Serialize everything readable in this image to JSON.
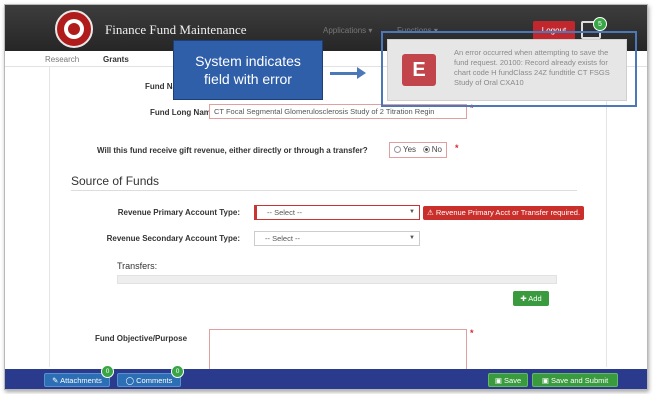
{
  "header": {
    "app_title": "Finance Fund Maintenance",
    "menu_applications": "Applications",
    "menu_functions": "Functions",
    "logout_label": "Logout",
    "notification_count": "5"
  },
  "tabs": [
    {
      "label": "Research"
    },
    {
      "label": "Grants"
    }
  ],
  "form": {
    "fund_name_label": "Fund Na",
    "fund_long_name_label": "Fund Long Name:",
    "fund_long_name_value": "CT Focal Segmental Glomerulosclerosis Study of 2 Titration Regin",
    "gift_question": "Will this fund receive gift revenue, either directly or through a transfer?",
    "gift_yes": "Yes",
    "gift_no": "No",
    "gift_selected": "No",
    "required_mark": "*",
    "section_title": "Source of Funds",
    "rev_primary_label": "Revenue Primary Account Type:",
    "rev_primary_value": "-- Select --",
    "rev_primary_error": "Revenue Primary Acct or Transfer required.",
    "rev_secondary_label": "Revenue Secondary Account Type:",
    "rev_secondary_value": "-- Select --",
    "transfers_label": "Transfers:",
    "add_label": "Add",
    "objective_label": "Fund Objective/Purpose"
  },
  "footer": {
    "attachments_label": "Attachments",
    "attachments_count": "0",
    "comments_label": "Comments",
    "comments_count": "0",
    "save_label": "Save",
    "save_submit_label": "Save and Submit"
  },
  "annotation": {
    "callout_line1": "System indicates",
    "callout_line2": "field with error"
  },
  "error_toast": {
    "icon_letter": "E",
    "message": "An error occurred when attempting to save the fund request. 20100: Record already exists for chart code H fundClass 24Z fundtitle CT FSGS Study of Oral CXA10"
  },
  "colors": {
    "navbar": "#2b2b2b",
    "brand_red": "#b01c1c",
    "error_red": "#c9302c",
    "success_green": "#3a9a3e",
    "footer_blue": "#2a3a8c",
    "callout_blue": "#2f5fa8"
  }
}
